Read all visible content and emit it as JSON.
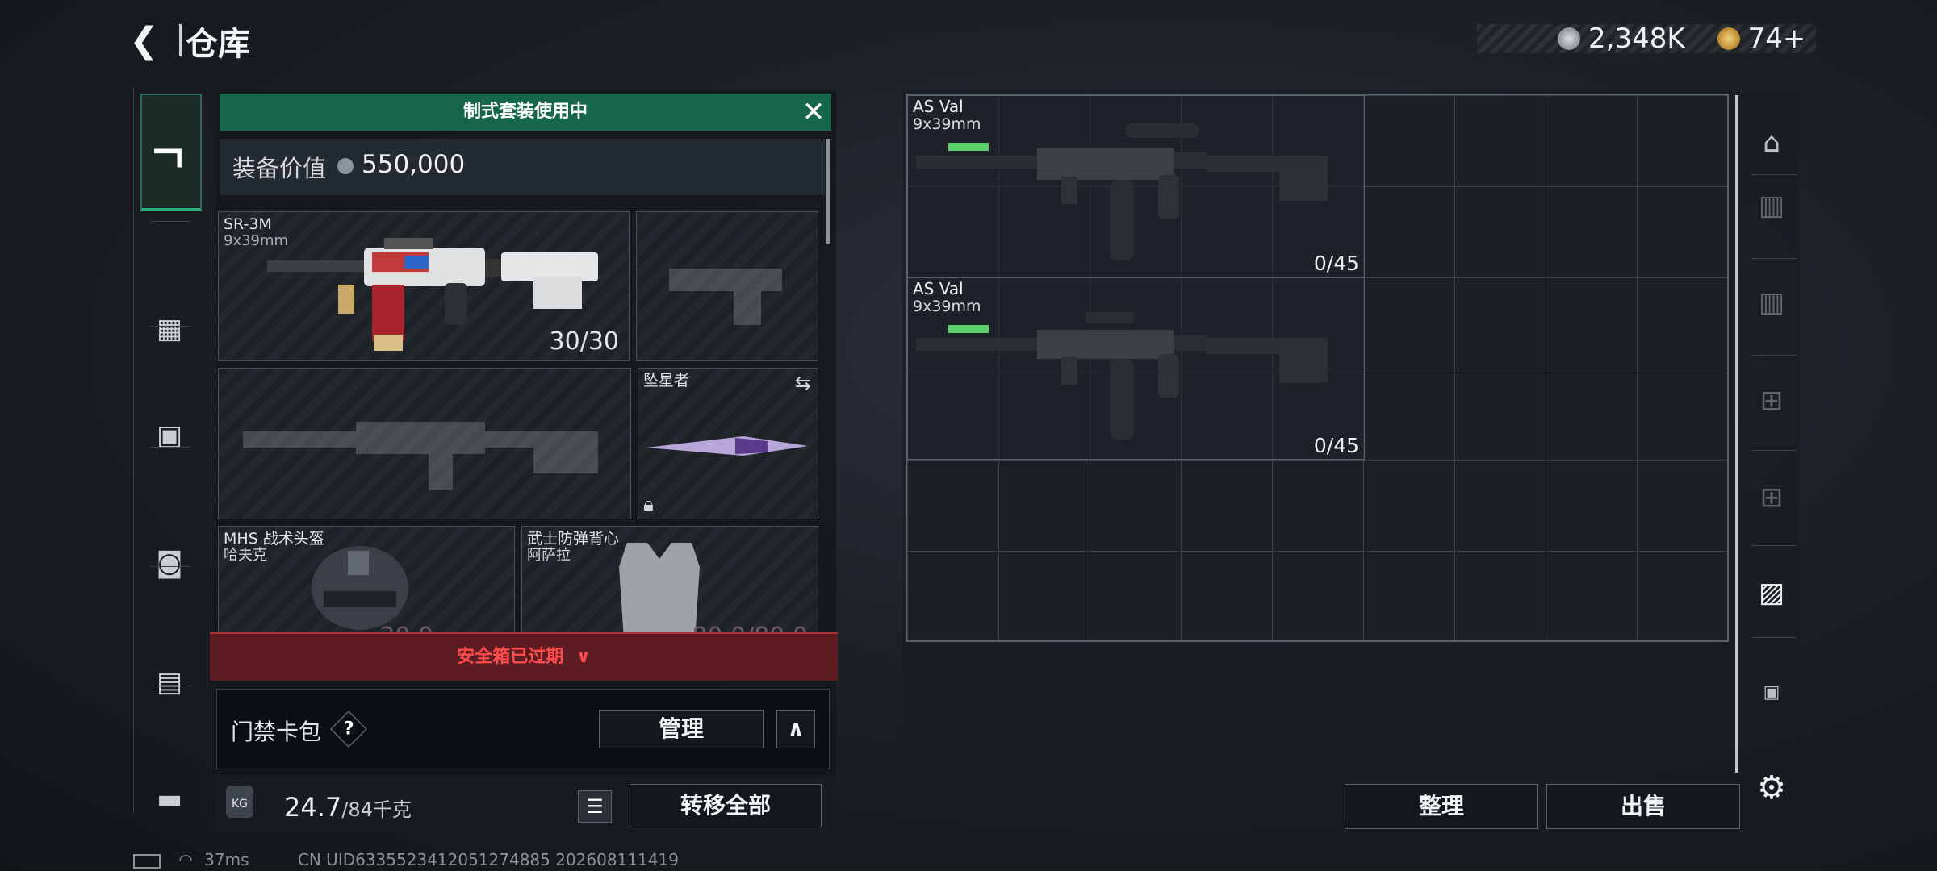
{
  "header": {
    "title": "仓库",
    "currency": [
      {
        "icon": "silver-coin-icon",
        "value": "2,348K",
        "color": "#b0b6bb"
      },
      {
        "icon": "gold-coin-icon",
        "value": "74+",
        "color": "#d6a74a"
      }
    ]
  },
  "left_nav": [
    {
      "icon": "pistol-icon",
      "active": true
    },
    {
      "icon": "armor-vest-icon",
      "active": false
    },
    {
      "icon": "backpack-icon",
      "active": false
    },
    {
      "icon": "bag-icon",
      "active": false
    },
    {
      "icon": "case-icon",
      "active": false
    },
    {
      "icon": "toolbox-icon",
      "active": false
    }
  ],
  "loadout": {
    "banner": "制式套装使用中",
    "value_label": "装备价值",
    "value": "550,000",
    "primary": {
      "name": "SR-3M",
      "caliber": "9x39mm",
      "ammo": "30/30"
    },
    "melee": {
      "name": "坠星者"
    },
    "helmet": {
      "name": "MHS 战术头盔",
      "sub": "哈夫克",
      "durability": "30.0"
    },
    "vest": {
      "name": "武士防弹背心",
      "sub": "阿萨拉",
      "durability": "80.0/80.0"
    },
    "safebox_expired": "安全箱已过期",
    "card_bag": {
      "label": "门禁卡包",
      "help": "?",
      "manage_label": "管理"
    },
    "weight": {
      "icon_label": "KG",
      "current": "24.7",
      "max": "/84千克"
    },
    "transfer_all_label": "转移全部"
  },
  "storage": {
    "items": [
      {
        "name": "AS Val",
        "caliber": "9x39mm",
        "ammo": "0/45"
      },
      {
        "name": "AS Val",
        "caliber": "9x39mm",
        "ammo": "0/45"
      }
    ],
    "sort_label": "整理",
    "sell_label": "出售"
  },
  "right_nav": [
    {
      "icon": "storage-home-icon"
    },
    {
      "icon": "storage-tier4-icon"
    },
    {
      "icon": "storage-tier4-icon-2"
    },
    {
      "icon": "storage-tier4-add-icon"
    },
    {
      "icon": "storage-tier4-add-icon-2"
    },
    {
      "icon": "storage-tier3-icon"
    },
    {
      "icon": "lock-icon"
    },
    {
      "icon": "settings-gear-icon"
    }
  ],
  "status_bar": {
    "ping": "37ms",
    "uid": "CN UID6335523412051274885 202608111419"
  }
}
